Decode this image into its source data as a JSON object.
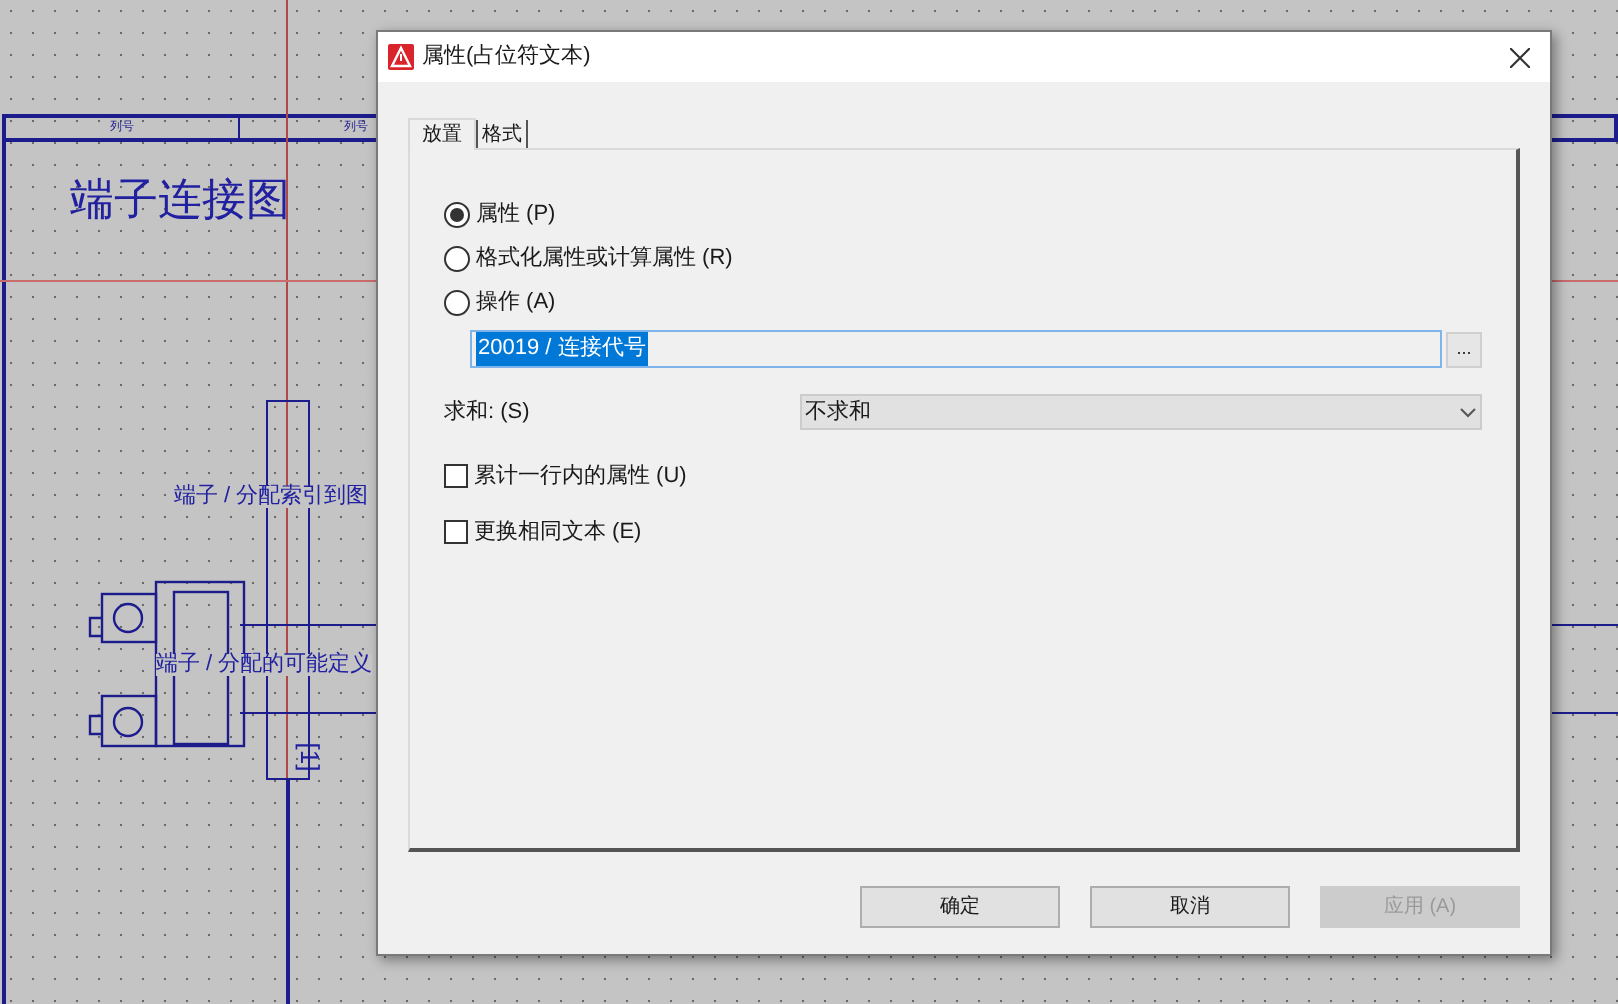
{
  "drawing": {
    "column_headers": [
      "列号",
      "列号"
    ],
    "title": "端子连接图",
    "labels": [
      "端子 / 分配索引到图",
      "端子 / 分配的可能定义"
    ],
    "bracket": "[1]"
  },
  "dialog": {
    "title": "属性(占位符文本)",
    "tabs": [
      {
        "label": "放置",
        "selected": true
      },
      {
        "label": "格式",
        "selected": false
      }
    ],
    "options": [
      {
        "label": "属性 (P)",
        "selected": true
      },
      {
        "label": "格式化属性或计算属性 (R)",
        "selected": false
      },
      {
        "label": "操作 (A)",
        "selected": false
      }
    ],
    "value_field": {
      "value": "20019 / 连接代号",
      "browse": "..."
    },
    "sum": {
      "label": "求和: (S)",
      "value": "不求和"
    },
    "checkboxes": [
      {
        "label": "累计一行内的属性 (U)",
        "checked": false
      },
      {
        "label": "更换相同文本 (E)",
        "checked": false
      }
    ],
    "buttons": [
      {
        "label": "确定",
        "disabled": false
      },
      {
        "label": "取消",
        "disabled": false
      },
      {
        "label": "应用 (A)",
        "disabled": true
      }
    ]
  }
}
